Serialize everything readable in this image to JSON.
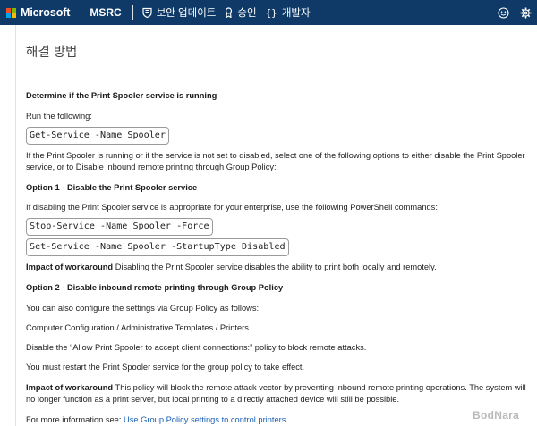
{
  "nav": {
    "brand": "Microsoft",
    "site": "MSRC",
    "items": [
      {
        "label": "보안 업데이트",
        "icon": "shield-icon"
      },
      {
        "label": "승인",
        "icon": "award-icon"
      },
      {
        "label": "개발자",
        "icon": "braces-icon"
      }
    ],
    "right_icons": [
      "smiley-feedback-icon",
      "gear-icon"
    ],
    "colors": {
      "bar": "#0f3a68",
      "ms_red": "#f25022",
      "ms_green": "#7fba00",
      "ms_blue": "#00a4ef",
      "ms_yellow": "#ffb900"
    }
  },
  "content": {
    "section_title": "해결 방법",
    "heading1": "Determine if the Print Spooler service is running",
    "run_following": "Run the following:",
    "code1": "Get-Service -Name Spooler",
    "para_running": "If the Print Spooler is running or if the service is not set to disabled, select one of the following options to either disable the Print Spooler service, or to Disable inbound remote printing through Group Policy:",
    "option1_heading": "Option 1 - Disable the Print Spooler service",
    "option1_text": "If disabling the Print Spooler service is appropriate for your enterprise, use the following PowerShell commands:",
    "code2": "Stop-Service -Name Spooler -Force",
    "code3": "Set-Service -Name Spooler -StartupType Disabled",
    "impact_label": "Impact of workaround",
    "impact1_text": " Disabling the Print Spooler service disables the ability to print both locally and remotely.",
    "option2_heading": "Option 2 - Disable inbound remote printing through Group Policy",
    "option2_text": "You can also configure the settings via Group Policy as follows:",
    "gp_path": "Computer Configuration / Administrative Templates / Printers",
    "disable_policy_text": "Disable the “Allow Print Spooler to accept client connections:” policy to block remote attacks.",
    "restart_text": "You must restart the Print Spooler service for the group policy to take effect.",
    "impact2_text": " This policy will block the remote attack vector by preventing inbound remote printing operations. The system will no longer function as a print server, but local printing to a directly attached device will still be possible.",
    "more_info_prefix": "For more information see: ",
    "more_info_link": "Use Group Policy settings to control printers",
    "more_info_suffix": "."
  },
  "watermark": "BodNara"
}
